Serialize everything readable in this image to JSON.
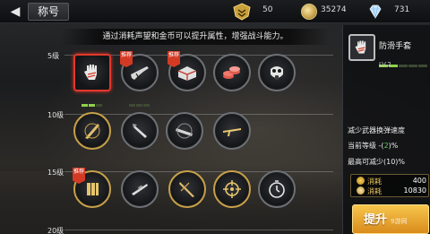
{
  "topbar": {
    "title": "称号",
    "rank_value": "50",
    "coin_value": "35274",
    "gem_value": "731"
  },
  "banner": "通过消耗声望和金币可以提升属性，增强战斗能力。",
  "tiers": [
    {
      "label": "5级"
    },
    {
      "label": "10级"
    },
    {
      "label": "15级"
    },
    {
      "label": "20级"
    }
  ],
  "tag_text": "推荐",
  "detail": {
    "name": "防滑手套",
    "level": "LV.2",
    "level_fraction": 0.4,
    "description": "减少武器换弹速度",
    "current_prefix": "当前等级 -(",
    "current_value": "2",
    "current_suffix": ")%",
    "max_text": "最高可减少(10)%",
    "cost_label": "消耗",
    "cost_rank": "400",
    "cost_coin": "10830",
    "upgrade_label": "提升"
  },
  "watermark": "9游网",
  "colors": {
    "accent": "#d98b1c",
    "selected": "#e2382c",
    "level_green": "#8fd24a",
    "highlight_green": "#57d14b"
  }
}
